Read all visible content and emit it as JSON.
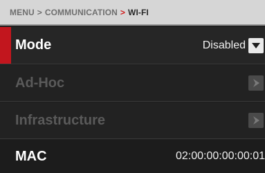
{
  "breadcrumb": {
    "menu": "MENU",
    "separator": ">",
    "communication": "COMMUNICATION",
    "current": "WI-FI"
  },
  "rows": {
    "mode": {
      "label": "Mode",
      "value": "Disabled",
      "icon": "chevron-down-icon"
    },
    "adhoc": {
      "label": "Ad-Hoc",
      "icon": "chevron-right-icon"
    },
    "infrastructure": {
      "label": "Infrastructure",
      "icon": "chevron-right-icon"
    },
    "mac": {
      "label": "MAC",
      "value": "02:00:00:00:00:01"
    }
  },
  "colors": {
    "accent": "#c2161e",
    "breadcrumb_bg": "#d6d6d6",
    "row_bg": "#222222",
    "disabled_text": "#5a5a5a"
  }
}
